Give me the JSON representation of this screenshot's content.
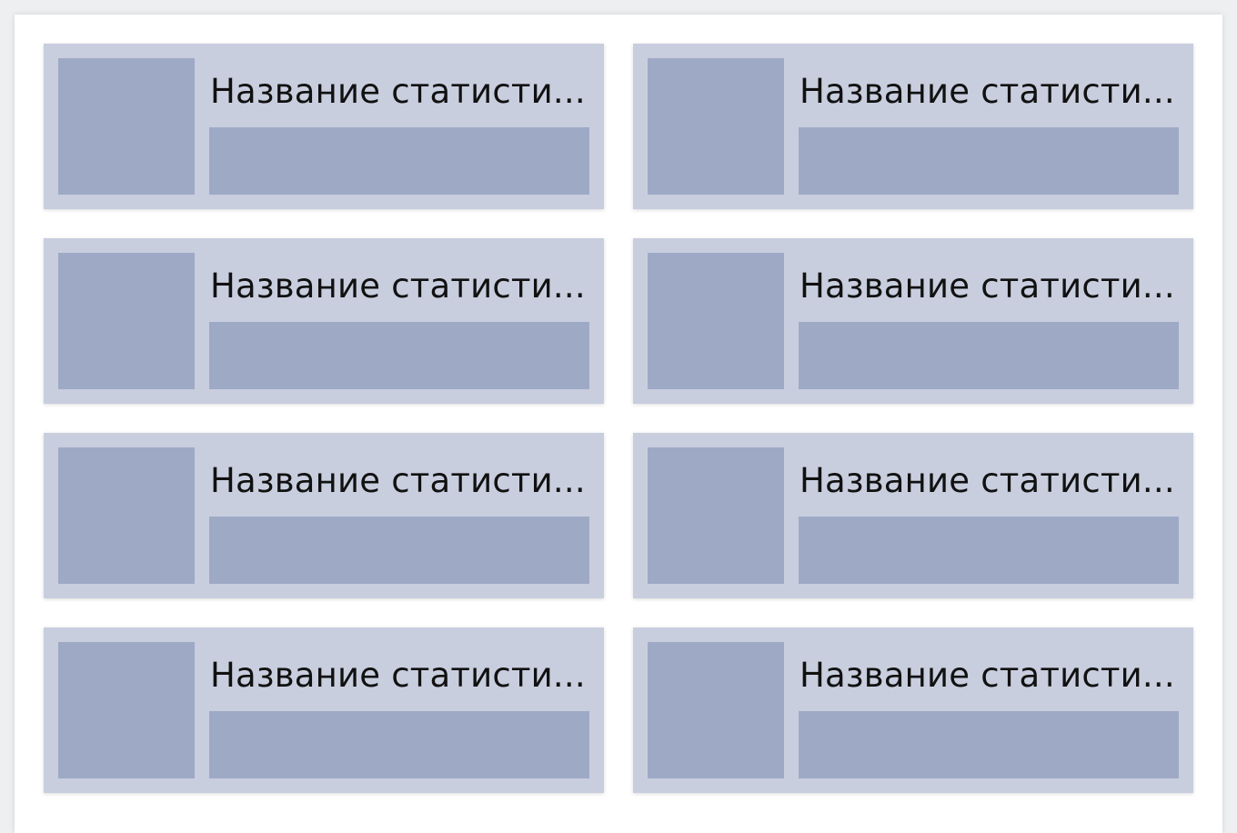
{
  "colors": {
    "page_background": "#ffffff",
    "card_background": "#c8cede",
    "placeholder": "#9ea9c6",
    "text": "#111111"
  },
  "stats": [
    {
      "title": "Название статисти..."
    },
    {
      "title": "Название статисти..."
    },
    {
      "title": "Название статисти..."
    },
    {
      "title": "Название статисти..."
    },
    {
      "title": "Название статисти..."
    },
    {
      "title": "Название статисти..."
    },
    {
      "title": "Название статисти..."
    },
    {
      "title": "Название статисти..."
    }
  ]
}
